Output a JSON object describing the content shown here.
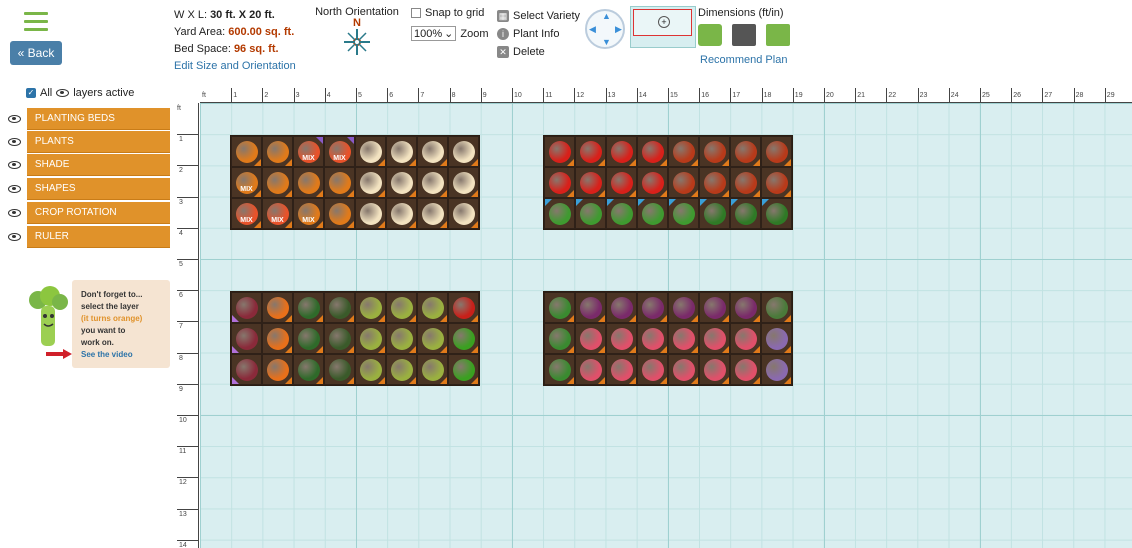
{
  "toolbar": {
    "back_label": "« Back",
    "dimensions_wl_prefix": "W X L: ",
    "dimensions_wl": "30 ft. X 20 ft.",
    "yard_area_label": "Yard Area: ",
    "yard_area": "600.00 sq. ft.",
    "bed_space_label": "Bed Space: ",
    "bed_space": "96 sq. ft.",
    "edit_link": "Edit Size and Orientation",
    "north_label": "North Orientation",
    "north_letter": "N",
    "snap_label": "Snap to grid",
    "zoom_value": "100%",
    "zoom_label": "Zoom",
    "select_variety": "Select Variety",
    "plant_info": "Plant Info",
    "delete": "Delete",
    "dimensions_label": "Dimensions (ft/in)",
    "recommend_label": "Recommend Plan"
  },
  "layers": {
    "all_label": "All",
    "active_label": "layers active",
    "items": [
      {
        "label": "PLANTING BEDS"
      },
      {
        "label": "PLANTS"
      },
      {
        "label": "SHADE"
      },
      {
        "label": "SHAPES"
      },
      {
        "label": "CROP ROTATION"
      },
      {
        "label": "RULER"
      }
    ]
  },
  "hint": {
    "line1": "Don't forget to...",
    "line2": "select the layer",
    "line3": "(it turns orange)",
    "line4": "you want to",
    "line5": "work on.",
    "video": "See the video"
  },
  "ruler": {
    "unit": "ft",
    "top_labels": [
      "1",
      "2",
      "3",
      "4",
      "5",
      "6",
      "7",
      "8",
      "9",
      "10",
      "11",
      "12",
      "13",
      "14",
      "15",
      "16",
      "17",
      "18",
      "19",
      "20",
      "21",
      "22",
      "23",
      "24",
      "25",
      "26",
      "27",
      "28",
      "29"
    ],
    "left_labels": [
      "1",
      "2",
      "3",
      "4",
      "5",
      "6",
      "7",
      "8",
      "9",
      "10",
      "11",
      "12",
      "13",
      "14"
    ]
  },
  "colors": {
    "layer_orange": "#e0922a",
    "link_blue": "#2c73a8",
    "highlight": "#b33a00",
    "grid_bg": "#d9eef0"
  },
  "beds": [
    {
      "name": "bed-top-left",
      "cells": [
        {
          "plant": "pumpkin",
          "color": "#e07a1a",
          "mix": ""
        },
        {
          "plant": "pumpkin",
          "color": "#e07a1a",
          "mix": ""
        },
        {
          "plant": "nasturtium-mix",
          "color": "#e8522a",
          "mix": "MIX"
        },
        {
          "plant": "nasturtium-mix",
          "color": "#e8522a",
          "mix": "MIX"
        },
        {
          "plant": "onion",
          "color": "#f2e2c0",
          "mix": ""
        },
        {
          "plant": "onion",
          "color": "#f2e2c0",
          "mix": ""
        },
        {
          "plant": "onion",
          "color": "#f2e2c0",
          "mix": ""
        },
        {
          "plant": "onion",
          "color": "#f2e2c0",
          "mix": ""
        },
        {
          "plant": "pumpkin-mix",
          "color": "#e07a1a",
          "mix": "MIX"
        },
        {
          "plant": "pumpkin",
          "color": "#e07a1a",
          "mix": ""
        },
        {
          "plant": "pumpkin",
          "color": "#e07a1a",
          "mix": ""
        },
        {
          "plant": "pumpkin",
          "color": "#e07a1a",
          "mix": ""
        },
        {
          "plant": "onion",
          "color": "#f2e2c0",
          "mix": ""
        },
        {
          "plant": "onion",
          "color": "#f2e2c0",
          "mix": ""
        },
        {
          "plant": "onion",
          "color": "#f2e2c0",
          "mix": ""
        },
        {
          "plant": "onion",
          "color": "#f2e2c0",
          "mix": ""
        },
        {
          "plant": "nasturtium-mix",
          "color": "#e8522a",
          "mix": "MIX"
        },
        {
          "plant": "nasturtium-mix",
          "color": "#e8522a",
          "mix": "MIX"
        },
        {
          "plant": "pumpkin-mix",
          "color": "#e07a1a",
          "mix": "MIX"
        },
        {
          "plant": "pumpkin",
          "color": "#e07a1a",
          "mix": ""
        },
        {
          "plant": "onion",
          "color": "#f2e2c0",
          "mix": ""
        },
        {
          "plant": "onion",
          "color": "#f2e2c0",
          "mix": ""
        },
        {
          "plant": "onion",
          "color": "#f2e2c0",
          "mix": ""
        },
        {
          "plant": "onion",
          "color": "#f2e2c0",
          "mix": ""
        }
      ]
    },
    {
      "name": "bed-top-right",
      "cells": [
        {
          "plant": "cherry-tomato",
          "color": "#d8201a",
          "mix": ""
        },
        {
          "plant": "cherry-tomato",
          "color": "#d8201a",
          "mix": ""
        },
        {
          "plant": "cherry-tomato",
          "color": "#d8201a",
          "mix": ""
        },
        {
          "plant": "cherry-tomato",
          "color": "#d8201a",
          "mix": ""
        },
        {
          "plant": "heirloom-tomato",
          "color": "#b83a1a",
          "mix": ""
        },
        {
          "plant": "heirloom-tomato",
          "color": "#b83a1a",
          "mix": ""
        },
        {
          "plant": "heirloom-tomato",
          "color": "#b83a1a",
          "mix": ""
        },
        {
          "plant": "heirloom-tomato",
          "color": "#b83a1a",
          "mix": ""
        },
        {
          "plant": "cherry-tomato",
          "color": "#d8201a",
          "mix": ""
        },
        {
          "plant": "cherry-tomato",
          "color": "#d8201a",
          "mix": ""
        },
        {
          "plant": "cherry-tomato",
          "color": "#d8201a",
          "mix": ""
        },
        {
          "plant": "cherry-tomato",
          "color": "#d8201a",
          "mix": ""
        },
        {
          "plant": "heirloom-tomato",
          "color": "#b83a1a",
          "mix": ""
        },
        {
          "plant": "heirloom-tomato",
          "color": "#b83a1a",
          "mix": ""
        },
        {
          "plant": "heirloom-tomato",
          "color": "#b83a1a",
          "mix": ""
        },
        {
          "plant": "heirloom-tomato",
          "color": "#b83a1a",
          "mix": ""
        },
        {
          "plant": "basil",
          "color": "#3f9a30",
          "mix": ""
        },
        {
          "plant": "basil",
          "color": "#3f9a30",
          "mix": ""
        },
        {
          "plant": "basil",
          "color": "#3f9a30",
          "mix": ""
        },
        {
          "plant": "basil",
          "color": "#3f9a30",
          "mix": ""
        },
        {
          "plant": "basil",
          "color": "#3f9a30",
          "mix": ""
        },
        {
          "plant": "parsley",
          "color": "#2f7a26",
          "mix": ""
        },
        {
          "plant": "parsley",
          "color": "#2f7a26",
          "mix": ""
        },
        {
          "plant": "parsley",
          "color": "#2f7a26",
          "mix": ""
        }
      ]
    },
    {
      "name": "bed-bottom-left",
      "cells": [
        {
          "plant": "sunflower",
          "color": "#8a2a3a",
          "mix": ""
        },
        {
          "plant": "carrot",
          "color": "#e8701a",
          "mix": ""
        },
        {
          "plant": "spinach",
          "color": "#2f6a2a",
          "mix": ""
        },
        {
          "plant": "kale",
          "color": "#3a5a2a",
          "mix": ""
        },
        {
          "plant": "lettuce",
          "color": "#9ab040",
          "mix": ""
        },
        {
          "plant": "lettuce",
          "color": "#9ab040",
          "mix": ""
        },
        {
          "plant": "lettuce",
          "color": "#9ab040",
          "mix": ""
        },
        {
          "plant": "red-pepper",
          "color": "#c8201a",
          "mix": ""
        },
        {
          "plant": "sunflower",
          "color": "#8a2a3a",
          "mix": ""
        },
        {
          "plant": "carrot",
          "color": "#e8701a",
          "mix": ""
        },
        {
          "plant": "spinach",
          "color": "#2f6a2a",
          "mix": ""
        },
        {
          "plant": "kale",
          "color": "#3a5a2a",
          "mix": ""
        },
        {
          "plant": "lettuce",
          "color": "#9ab040",
          "mix": ""
        },
        {
          "plant": "lettuce",
          "color": "#9ab040",
          "mix": ""
        },
        {
          "plant": "lettuce",
          "color": "#9ab040",
          "mix": ""
        },
        {
          "plant": "green-pepper",
          "color": "#3aa020",
          "mix": ""
        },
        {
          "plant": "sunflower",
          "color": "#8a2a3a",
          "mix": ""
        },
        {
          "plant": "carrot",
          "color": "#e8701a",
          "mix": ""
        },
        {
          "plant": "spinach",
          "color": "#2f6a2a",
          "mix": ""
        },
        {
          "plant": "kale",
          "color": "#3a5a2a",
          "mix": ""
        },
        {
          "plant": "lettuce",
          "color": "#9ab040",
          "mix": ""
        },
        {
          "plant": "lettuce",
          "color": "#9ab040",
          "mix": ""
        },
        {
          "plant": "lettuce",
          "color": "#9ab040",
          "mix": ""
        },
        {
          "plant": "green-pepper",
          "color": "#3aa020",
          "mix": ""
        }
      ]
    },
    {
      "name": "bed-bottom-right",
      "cells": [
        {
          "plant": "mint",
          "color": "#3a8a30",
          "mix": ""
        },
        {
          "plant": "red-onion",
          "color": "#7a2a6a",
          "mix": ""
        },
        {
          "plant": "red-onion",
          "color": "#7a2a6a",
          "mix": ""
        },
        {
          "plant": "red-onion",
          "color": "#7a2a6a",
          "mix": ""
        },
        {
          "plant": "red-onion",
          "color": "#7a2a6a",
          "mix": ""
        },
        {
          "plant": "red-onion",
          "color": "#7a2a6a",
          "mix": ""
        },
        {
          "plant": "red-onion",
          "color": "#7a2a6a",
          "mix": ""
        },
        {
          "plant": "rosemary",
          "color": "#4a7a3a",
          "mix": ""
        },
        {
          "plant": "mint",
          "color": "#3a8a30",
          "mix": ""
        },
        {
          "plant": "potato",
          "color": "#e0506a",
          "mix": ""
        },
        {
          "plant": "potato",
          "color": "#e0506a",
          "mix": ""
        },
        {
          "plant": "potato",
          "color": "#e0506a",
          "mix": ""
        },
        {
          "plant": "potato",
          "color": "#e0506a",
          "mix": ""
        },
        {
          "plant": "potato",
          "color": "#e0506a",
          "mix": ""
        },
        {
          "plant": "potato",
          "color": "#e0506a",
          "mix": ""
        },
        {
          "plant": "lavender",
          "color": "#8a6ab0",
          "mix": ""
        },
        {
          "plant": "mint",
          "color": "#3a8a30",
          "mix": ""
        },
        {
          "plant": "potato",
          "color": "#e0506a",
          "mix": ""
        },
        {
          "plant": "potato",
          "color": "#e0506a",
          "mix": ""
        },
        {
          "plant": "potato",
          "color": "#e0506a",
          "mix": ""
        },
        {
          "plant": "potato",
          "color": "#e0506a",
          "mix": ""
        },
        {
          "plant": "potato",
          "color": "#e0506a",
          "mix": ""
        },
        {
          "plant": "potato",
          "color": "#e0506a",
          "mix": ""
        },
        {
          "plant": "lavender",
          "color": "#8a6ab0",
          "mix": ""
        }
      ]
    }
  ]
}
